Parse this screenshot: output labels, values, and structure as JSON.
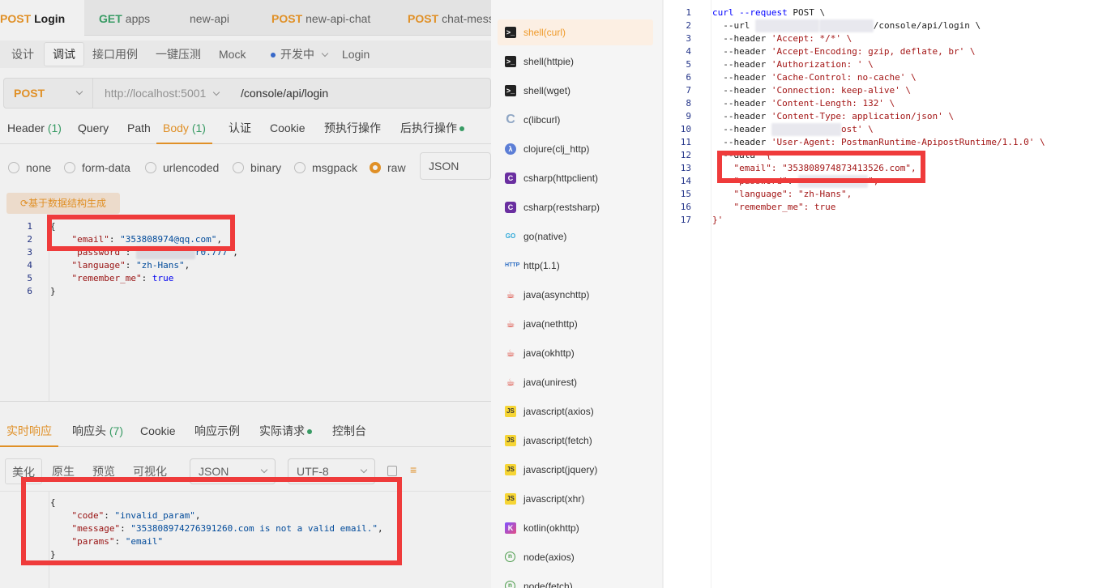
{
  "tabs": [
    {
      "method": "POST",
      "name": "Login"
    },
    {
      "method": "GET",
      "name": "apps"
    },
    {
      "method": "",
      "name": "new-api"
    },
    {
      "method": "POST",
      "name": "new-api-chat"
    },
    {
      "method": "POST",
      "name": "chat-messa"
    }
  ],
  "toolbar": {
    "design": "设计",
    "debug": "调试",
    "examples": "接口用例",
    "stress": "一键压测",
    "mock": "Mock",
    "status": "开发中",
    "title": "Login"
  },
  "request": {
    "method": "POST",
    "base_url": "http://localhost:5001",
    "path": "/console/api/login"
  },
  "subtabs": {
    "header": "Header",
    "header_count": "(1)",
    "query": "Query",
    "path": "Path",
    "body": "Body",
    "body_count": "(1)",
    "auth": "认证",
    "cookie": "Cookie",
    "pre": "预执行操作",
    "post": "后执行操作"
  },
  "body_types": {
    "none": "none",
    "form_data": "form-data",
    "urlencoded": "urlencoded",
    "binary": "binary",
    "msgpack": "msgpack",
    "raw": "raw",
    "format": "JSON"
  },
  "gen_button": "基于数据结构生成",
  "body_editor": {
    "line_numbers": [
      "1",
      "2",
      "3",
      "4",
      "5",
      "6"
    ],
    "open_brace": "{",
    "email_key": "\"email\"",
    "email_value": "\"353808974@qq.com\"",
    "password_key": "\"password\"",
    "password_tail": "r0.777\"",
    "language_key": "\"language\"",
    "language_value": "\"zh-Hans\"",
    "remember_key": "\"remember_me\"",
    "remember_value": "true",
    "close_brace": "}"
  },
  "response_tabs": {
    "realtime": "实时响应",
    "headers": "响应头",
    "headers_count": "(7)",
    "cookie": "Cookie",
    "example": "响应示例",
    "actual": "实际请求",
    "console": "控制台"
  },
  "response_bar": {
    "pretty": "美化",
    "raw": "原生",
    "preview": "预览",
    "visual": "可视化",
    "format": "JSON",
    "encoding": "UTF-8"
  },
  "response_body": {
    "open_brace": "{",
    "code_key": "\"code\"",
    "code_value": "\"invalid_param\"",
    "message_key": "\"message\"",
    "message_value": "\"353808974276391260.com is not a valid email.\"",
    "params_key": "\"params\"",
    "params_value": "\"email\"",
    "close_brace": "}"
  },
  "languages": [
    {
      "name": "shell(curl)",
      "icon": "shell-icon"
    },
    {
      "name": "shell(httpie)",
      "icon": "shell-icon"
    },
    {
      "name": "shell(wget)",
      "icon": "shell-icon"
    },
    {
      "name": "c(libcurl)",
      "icon": "c-icon"
    },
    {
      "name": "clojure(clj_http)",
      "icon": "clojure-icon"
    },
    {
      "name": "csharp(httpclient)",
      "icon": "csharp-icon"
    },
    {
      "name": "csharp(restsharp)",
      "icon": "csharp-icon"
    },
    {
      "name": "go(native)",
      "icon": "go-icon"
    },
    {
      "name": "http(1.1)",
      "icon": "http-icon"
    },
    {
      "name": "java(asynchttp)",
      "icon": "java-icon"
    },
    {
      "name": "java(nethttp)",
      "icon": "java-icon"
    },
    {
      "name": "java(okhttp)",
      "icon": "java-icon"
    },
    {
      "name": "java(unirest)",
      "icon": "java-icon"
    },
    {
      "name": "javascript(axios)",
      "icon": "javascript-icon"
    },
    {
      "name": "javascript(fetch)",
      "icon": "javascript-icon"
    },
    {
      "name": "javascript(jquery)",
      "icon": "javascript-icon"
    },
    {
      "name": "javascript(xhr)",
      "icon": "javascript-icon"
    },
    {
      "name": "kotlin(okhttp)",
      "icon": "kotlin-icon"
    },
    {
      "name": "node(axios)",
      "icon": "node-icon"
    },
    {
      "name": "node(fetch)",
      "icon": "node-icon"
    }
  ],
  "code_view": {
    "line_numbers": [
      "1",
      "2",
      "3",
      "4",
      "5",
      "6",
      "7",
      "8",
      "9",
      "10",
      "11",
      "12",
      "13",
      "14",
      "15",
      "16",
      "17"
    ],
    "curl_cmd": "curl",
    "curl_flag": "--request",
    "curl_method": "POST \\",
    "url_flag": "--url",
    "url_tail": "/console/api/login \\",
    "header_flag": "--header",
    "header_accept": "'Accept: */*' \\",
    "header_encoding": "'Accept-Encoding: gzip, deflate, br' \\",
    "header_auth": "'Authorization: ' \\",
    "header_cache": "'Cache-Control: no-cache' \\",
    "header_connection": "'Connection: keep-alive' \\",
    "header_length": "'Content-Length: 132' \\",
    "header_ctype": "'Content-Type: application/json' \\",
    "header_cookie_tail": "ost' \\",
    "header_ua": "'User-Agent: PostmanRuntime-ApipostRuntime/1.1.0' \\",
    "data_flag": "--data",
    "data_open": "'{",
    "email_line": "\"email\": \"353808974873413526.com\",",
    "password_key": "\"password\"",
    "password_tail": "\",",
    "language_line": "\"language\": \"zh-Hans\",",
    "remember_line": "\"remember_me\": true",
    "close": "}'"
  }
}
